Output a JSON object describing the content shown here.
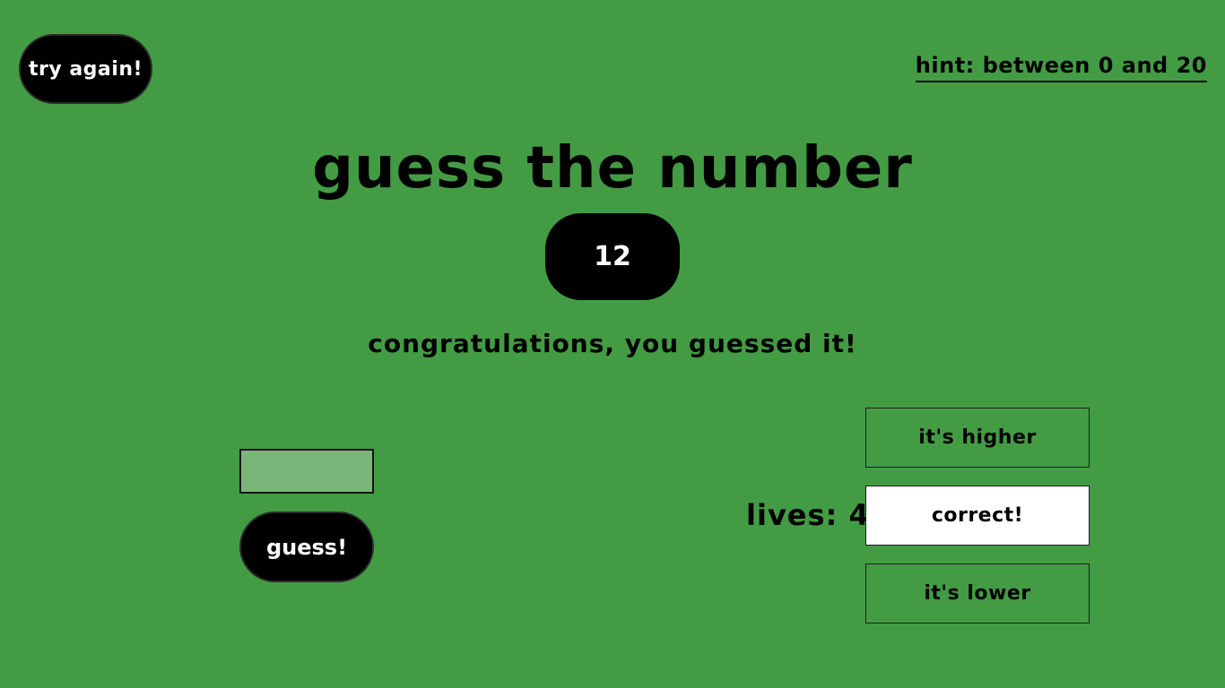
{
  "try_again_label": "try again!",
  "hint": "hint: between 0 and 20",
  "title": "guess the number",
  "secret_number": "12",
  "message": "congratulations, you guessed it!",
  "guess_input": {
    "value": "",
    "placeholder": ""
  },
  "guess_button_label": "guess!",
  "lives": "lives: 4",
  "answers": {
    "higher": "it's higher",
    "correct": "correct!",
    "lower": "it's lower"
  },
  "colors": {
    "background": "#439c44",
    "button": "#000000",
    "input": "#7ab57a",
    "active_answer": "#ffffff"
  }
}
